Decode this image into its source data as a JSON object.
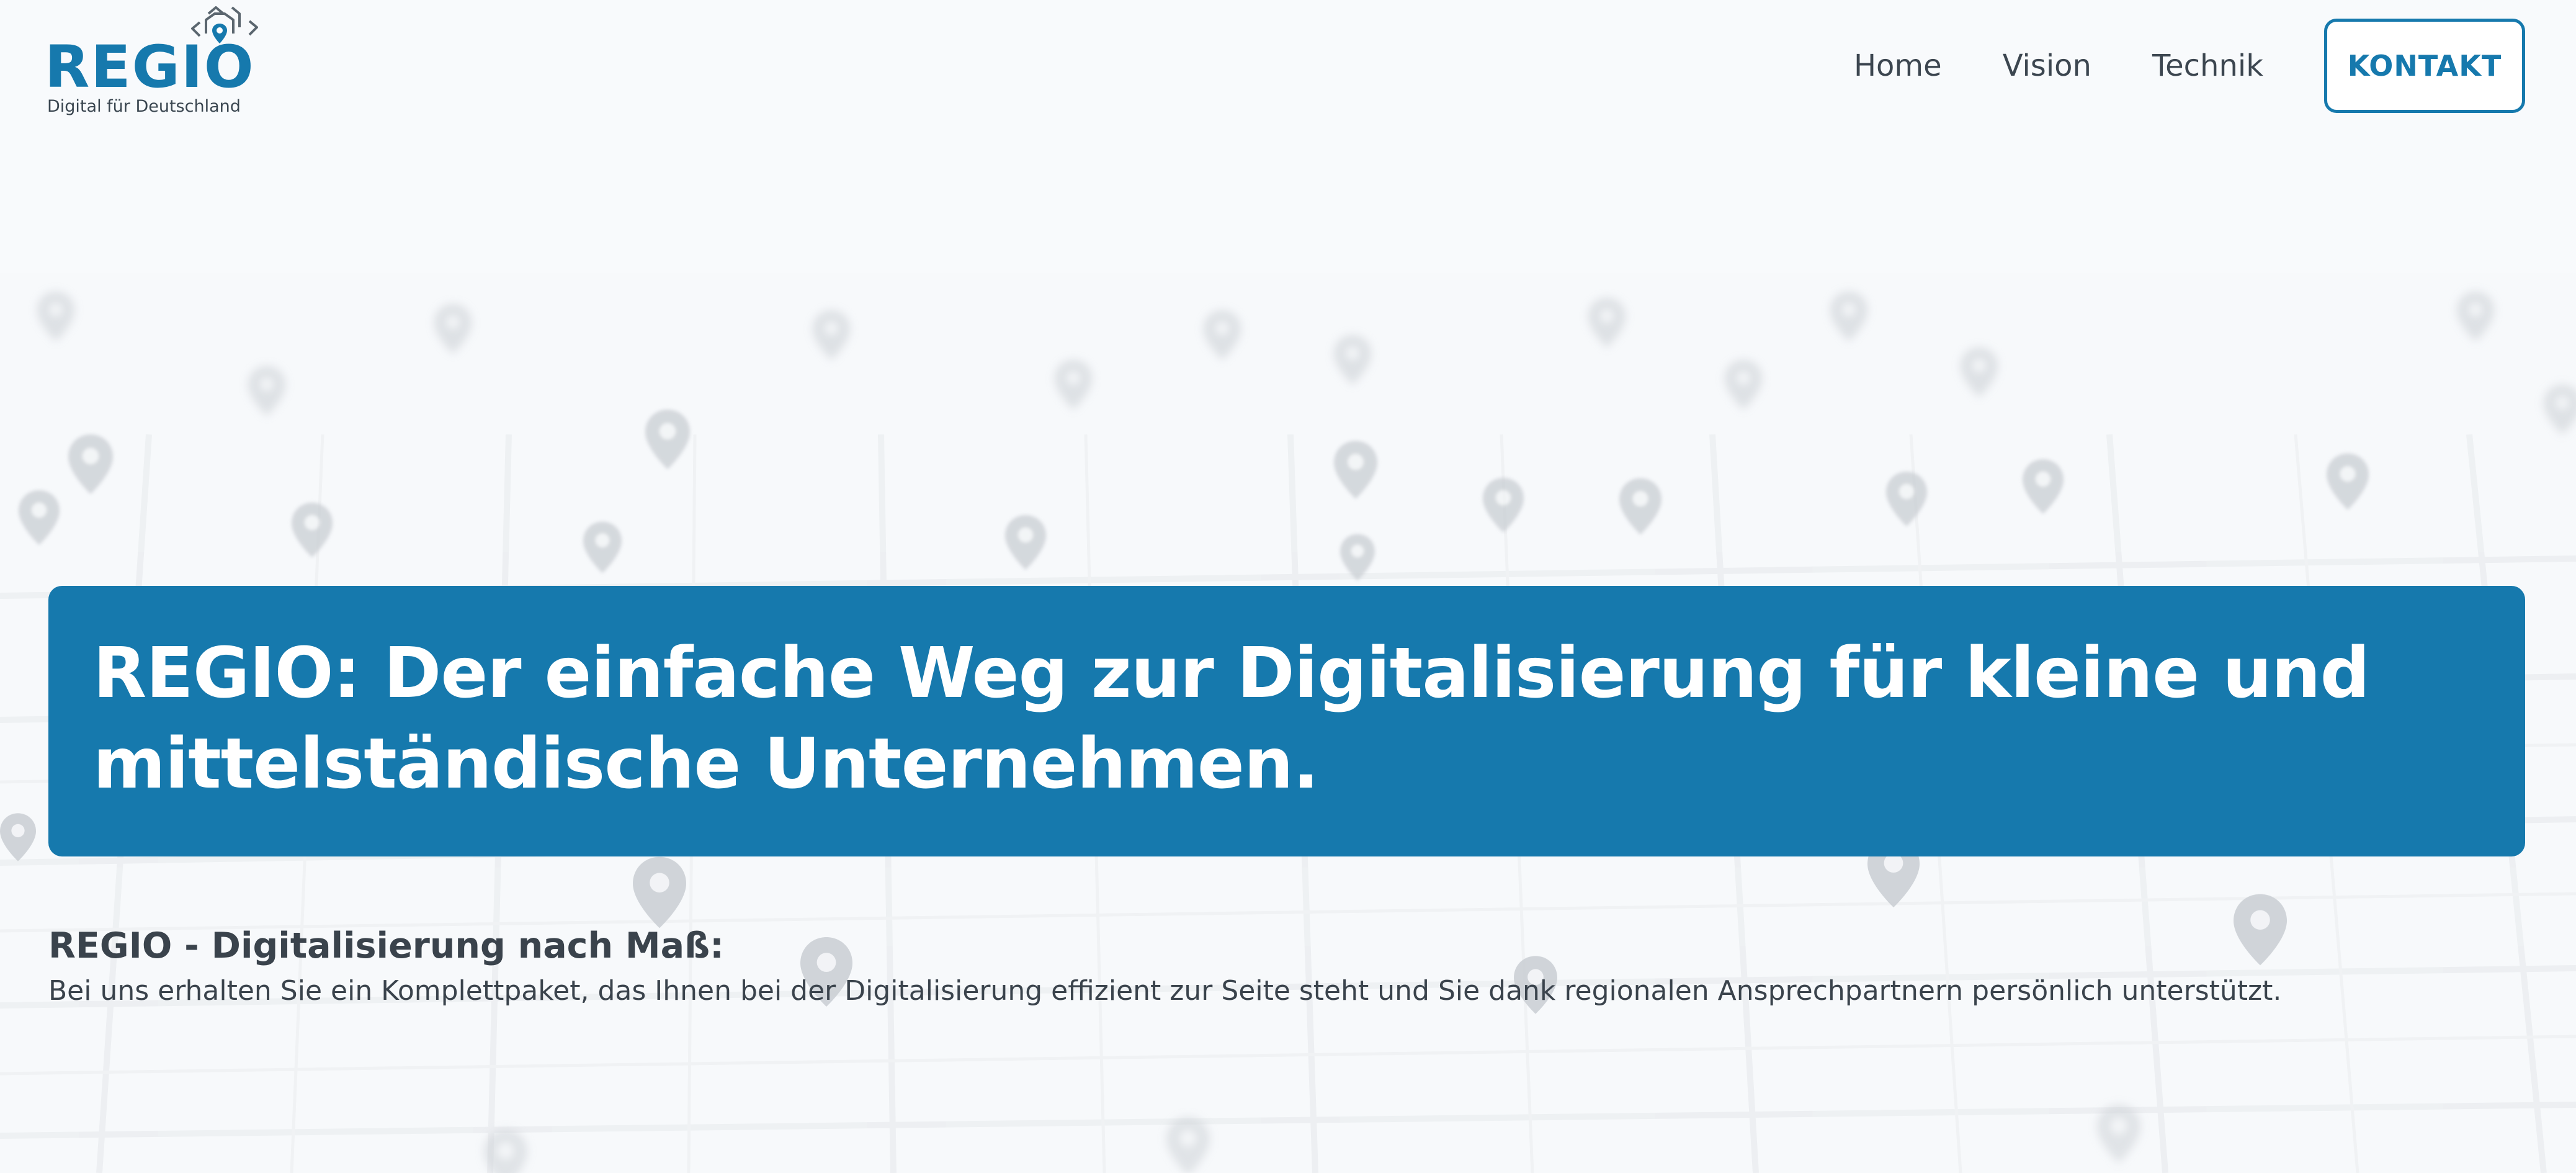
{
  "header": {
    "logo": {
      "wordmark": "REGIO",
      "tagline": "Digital für Deutschland",
      "icon": "hexagon-pin-icon"
    },
    "nav": {
      "items": [
        {
          "label": "Home"
        },
        {
          "label": "Vision"
        },
        {
          "label": "Technik"
        }
      ],
      "cta_label": "KONTAKT"
    }
  },
  "hero": {
    "title": "REGIO: Der einfache Weg zur Digitalisierung für kleine und mittelständische Unternehmen."
  },
  "intro": {
    "heading": "REGIO - Digitalisierung nach Maß:",
    "text": "Bei uns erhalten Sie ein Komplettpaket, das Ihnen bei der Digitalisierung effizient zur Seite steht und Sie dank regionalen Ansprechpartnern persönlich unterstützt."
  },
  "colors": {
    "brand_blue": "#1679ad",
    "text_dark": "#3a434c",
    "background": "#f7f9fb",
    "white": "#ffffff"
  }
}
